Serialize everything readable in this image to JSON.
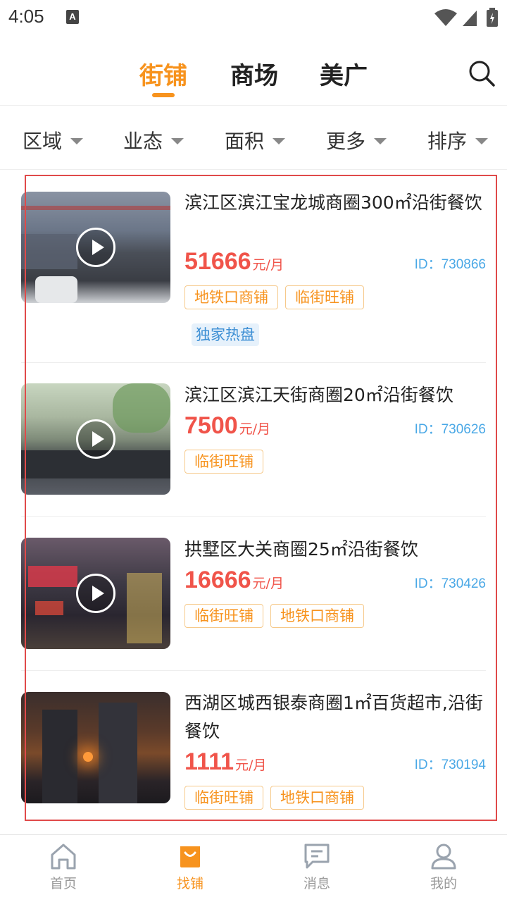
{
  "status_bar": {
    "time": "4:05",
    "notification_icon": "A"
  },
  "top_tabs": [
    {
      "label": "街铺",
      "active": true
    },
    {
      "label": "商场",
      "active": false
    },
    {
      "label": "美广",
      "active": false
    }
  ],
  "filters": [
    {
      "label": "区域"
    },
    {
      "label": "业态"
    },
    {
      "label": "面积"
    },
    {
      "label": "更多"
    },
    {
      "label": "排序"
    }
  ],
  "listings": [
    {
      "title": "滨江区滨江宝龙城商圈300㎡沿街餐饮",
      "price": "51666",
      "unit": "元/月",
      "id": "ID：730866",
      "tags": [
        "地铁口商铺",
        "临街旺铺"
      ],
      "badge": "独家热盘"
    },
    {
      "title": "滨江区滨江天街商圈20㎡沿街餐饮",
      "price": "7500",
      "unit": "元/月",
      "id": "ID：730626",
      "tags": [
        "临街旺铺"
      ]
    },
    {
      "title": "拱墅区大关商圈25㎡沿街餐饮",
      "price": "16666",
      "unit": "元/月",
      "id": "ID：730426",
      "tags": [
        "临街旺铺",
        "地铁口商铺"
      ]
    },
    {
      "title": "西湖区城西银泰商圈1㎡百货超市,沿街餐饮",
      "price": "1111",
      "unit": "元/月",
      "id": "ID：730194",
      "tags": [
        "临街旺铺",
        "地铁口商铺"
      ]
    }
  ],
  "bottom_nav": [
    {
      "label": "首页",
      "icon": "home-icon",
      "active": false
    },
    {
      "label": "找铺",
      "icon": "shop-bag-icon",
      "active": true
    },
    {
      "label": "消息",
      "icon": "message-icon",
      "active": false
    },
    {
      "label": "我的",
      "icon": "profile-icon",
      "active": false
    }
  ],
  "colors": {
    "accent": "#f7931e",
    "price": "#f0544a",
    "id": "#4aa8e6",
    "highlight_box": "#e04a4a"
  }
}
